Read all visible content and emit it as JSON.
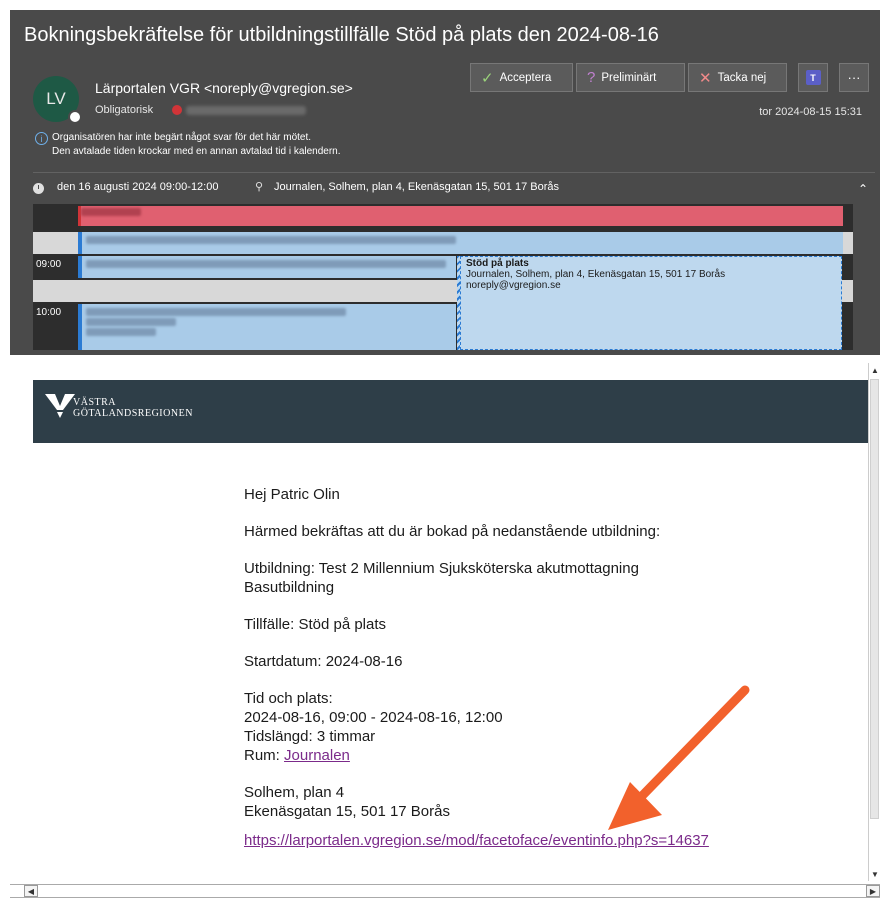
{
  "email": {
    "subject": "Bokningsbekräftelse för utbildningstillfälle Stöd på plats den 2024-08-16",
    "avatar_initials": "LV",
    "sender": "Lärportalen VGR <noreply@vgregion.se>",
    "required_label": "Obligatorisk",
    "timestamp": "tor 2024-08-15 15:31",
    "info_line1": "Organisatören har inte begärt något svar för det här mötet.",
    "info_line2": "Den avtalade tiden krockar med en annan avtalad tid i kalendern.",
    "when": "den 16 augusti 2024 09:00-12:00",
    "where": "Journalen, Solhem, plan 4, Ekenäsgatan 15, 501 17 Borås"
  },
  "actions": {
    "accept": "Acceptera",
    "tentative": "Preliminärt",
    "decline": "Tacka nej",
    "more": "···",
    "teams": "T"
  },
  "calendar": {
    "times": [
      "09:00",
      "10:00"
    ],
    "event_title": "Stöd på plats",
    "event_location": "Journalen, Solhem, plan 4, Ekenäsgatan 15, 501 17 Borås",
    "event_organizer": "noreply@vgregion.se"
  },
  "banner": {
    "line1": "VÄSTRA",
    "line2": "GÖTALANDSREGIONEN"
  },
  "letter": {
    "greeting": "Hej Patric Olin",
    "intro": "Härmed bekräftas att du är bokad på nedanstående utbildning:",
    "course_line1": "Utbildning: Test 2 Millennium Sjuksköterska akutmottagning",
    "course_line2": "Basutbildning",
    "occasion": "Tillfälle: Stöd på plats",
    "start_date": "Startdatum: 2024-08-16",
    "time_place_heading": "Tid och plats:",
    "time_range": "2024-08-16, 09:00 - 2024-08-16, 12:00",
    "duration": "Tidslängd: 3 timmar",
    "room_label": "Rum: ",
    "room_link": "Journalen",
    "address1": "Solhem, plan 4",
    "address2": "Ekenäsgatan 15, 501 17 Borås",
    "event_url": "https://larportalen.vgregion.se/mod/facetoface/eventinfo.php?s=14637"
  },
  "colors": {
    "header_bg": "#4a4a4a",
    "avatar_bg": "#1e5945",
    "banner_bg": "#2e3e48",
    "arrow": "#f2612c",
    "link": "#7b2a8a"
  }
}
